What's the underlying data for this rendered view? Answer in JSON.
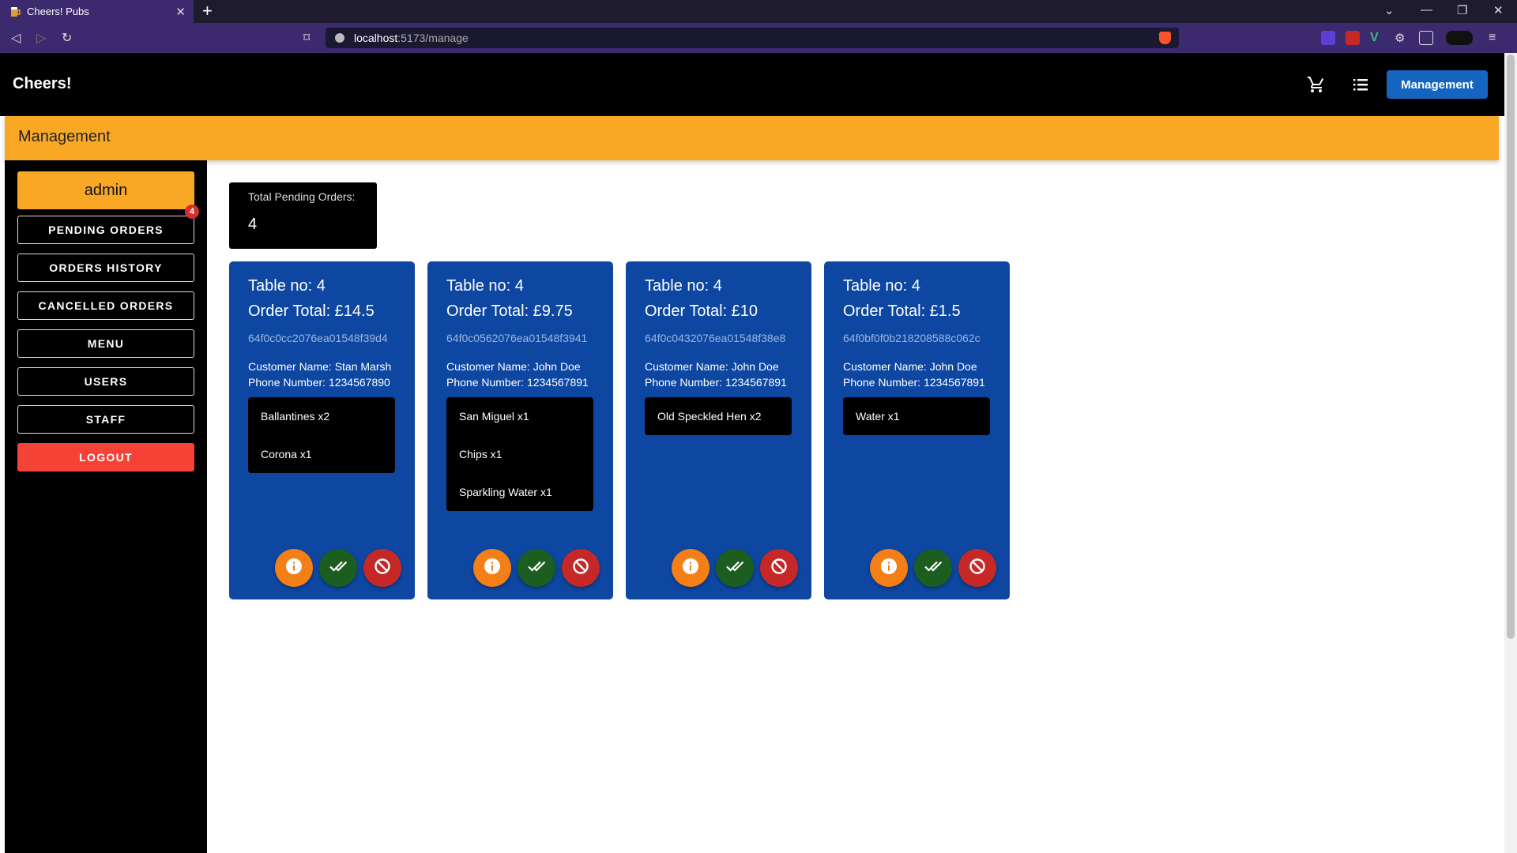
{
  "browser": {
    "tab_title": "Cheers! Pubs",
    "url_host": "localhost",
    "url_path": ":5173/manage"
  },
  "header": {
    "app_title": "Cheers!",
    "management_button": "Management"
  },
  "page": {
    "banner_title": "Management"
  },
  "sidebar": {
    "user": "admin",
    "pending_badge": "4",
    "items": [
      {
        "label": "PENDING ORDERS"
      },
      {
        "label": "ORDERS HISTORY"
      },
      {
        "label": "CANCELLED ORDERS"
      },
      {
        "label": "MENU"
      },
      {
        "label": "USERS"
      },
      {
        "label": "STAFF"
      },
      {
        "label": "LOGOUT"
      }
    ]
  },
  "summary": {
    "total_label": "Total Pending Orders:",
    "total_value": "4"
  },
  "orders": [
    {
      "table": "Table no: 4",
      "total": "Order Total: £14.5",
      "id": "64f0c0cc2076ea01548f39d4",
      "customer": "Customer Name: Stan Marsh",
      "phone": "Phone Number: 1234567890",
      "items": [
        "Ballantines x2",
        "Corona x1"
      ]
    },
    {
      "table": "Table no: 4",
      "total": "Order Total: £9.75",
      "id": "64f0c0562076ea01548f3941",
      "customer": "Customer Name: John Doe",
      "phone": "Phone Number: 1234567891",
      "items": [
        "San Miguel x1",
        "Chips x1",
        "Sparkling Water x1"
      ]
    },
    {
      "table": "Table no: 4",
      "total": "Order Total: £10",
      "id": "64f0c0432076ea01548f38e8",
      "customer": "Customer Name: John Doe",
      "phone": "Phone Number: 1234567891",
      "items": [
        "Old Speckled Hen x2"
      ]
    },
    {
      "table": "Table no: 4",
      "total": "Order Total: £1.5",
      "id": "64f0bf0f0b218208588c062c",
      "customer": "Customer Name: John Doe",
      "phone": "Phone Number: 1234567891",
      "items": [
        "Water x1"
      ]
    }
  ],
  "colors": {
    "header_bg": "#000000",
    "accent_orange": "#f9a825",
    "card_blue": "#0d47a1",
    "button_blue": "#1565c0",
    "logout_red": "#f44336",
    "info_orange": "#f57f17",
    "done_green": "#1b5e20",
    "cancel_red": "#c62828"
  },
  "icons": {
    "cart": "cart-icon",
    "list": "list-icon",
    "info": "info-icon",
    "complete": "double-check-icon",
    "cancel": "block-icon"
  }
}
